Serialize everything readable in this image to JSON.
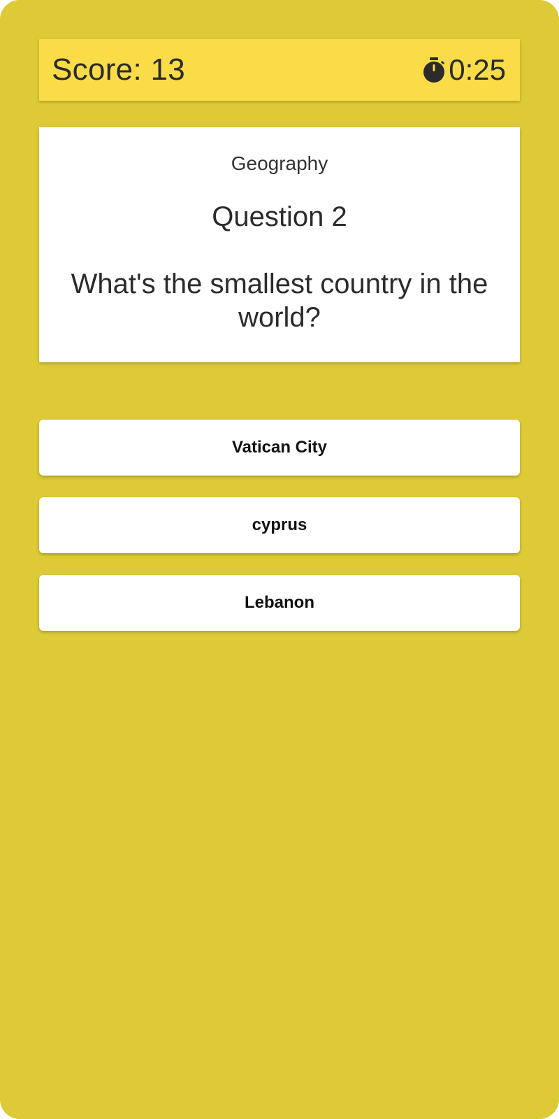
{
  "header": {
    "score_text": "Score: 13",
    "timer_text": "0:25",
    "timer_icon": "stopwatch-icon"
  },
  "question": {
    "category": "Geography",
    "number_label": "Question 2",
    "text": "What's the smallest country in the world?"
  },
  "answers": [
    {
      "label": "Vatican City"
    },
    {
      "label": "cyprus"
    },
    {
      "label": "Lebanon"
    }
  ],
  "colors": {
    "background": "#ddca36",
    "header_bar": "#f9dc47",
    "card": "#ffffff",
    "text": "#2b2b2b"
  }
}
